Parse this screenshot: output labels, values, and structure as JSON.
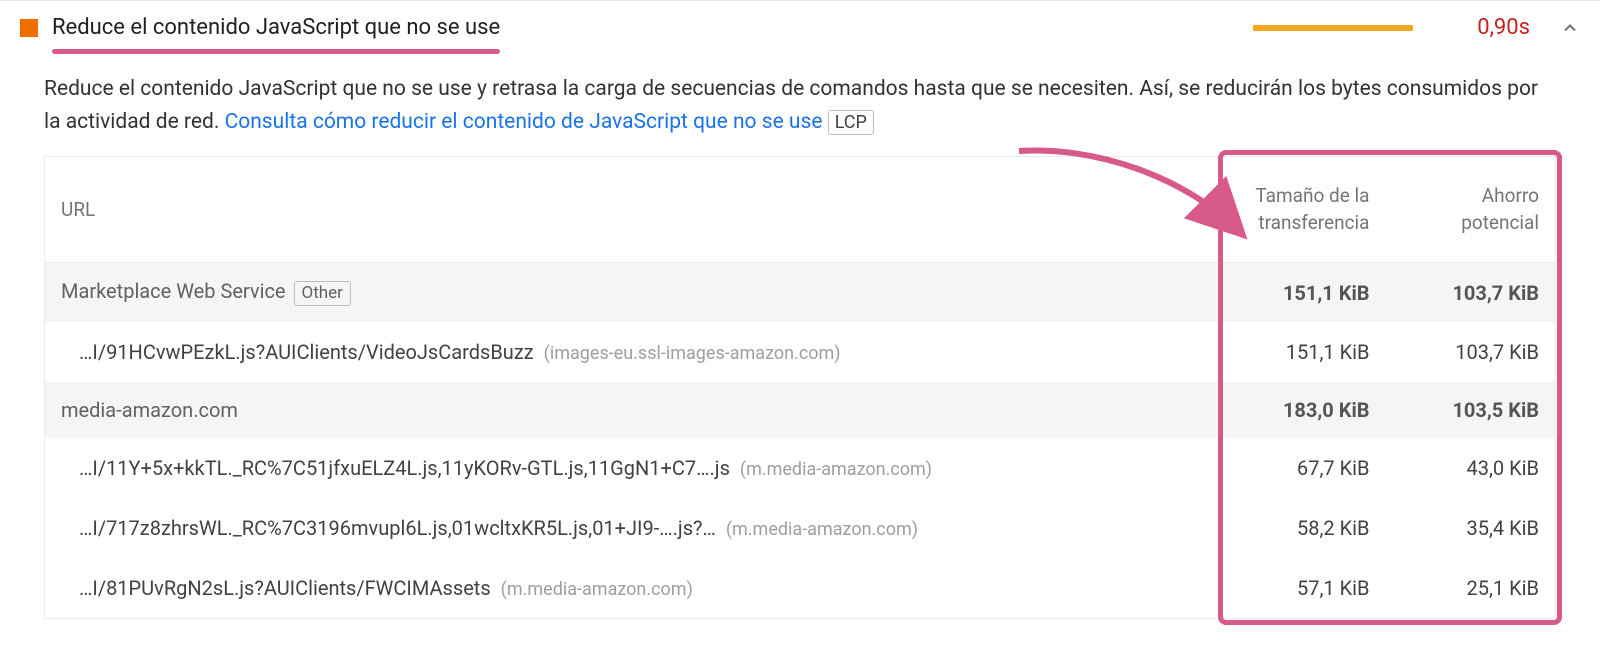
{
  "audit": {
    "title": "Reduce el contenido JavaScript que no se use",
    "time": "0,90s",
    "description_pre": "Reduce el contenido JavaScript que no se use y retrasa la carga de secuencias de comandos hasta que se necesiten. Así, se reducirán los bytes consumidos por la actividad de red. ",
    "link_text": "Consulta cómo reducir el contenido de JavaScript que no se use",
    "badge": "LCP"
  },
  "table": {
    "headers": {
      "url": "URL",
      "transfer": "Tamaño de la transferencia",
      "savings": "Ahorro potencial"
    },
    "rows": [
      {
        "type": "group",
        "label": "Marketplace Web Service",
        "tag": "Other",
        "transfer": "151,1 KiB",
        "savings": "103,7 KiB"
      },
      {
        "type": "item",
        "label": "…I/91HCvwPEzkL.js?AUIClients/VideoJsCardsBuzz",
        "domain": "(images-eu.ssl-images-amazon.com)",
        "transfer": "151,1 KiB",
        "savings": "103,7 KiB"
      },
      {
        "type": "group",
        "label": "media-amazon.com",
        "transfer": "183,0 KiB",
        "savings": "103,5 KiB"
      },
      {
        "type": "item",
        "label": "…I/11Y+5x+kkTL._RC%7C51jfxuELZ4L.js,11yKORv-GTL.js,11GgN1+C7….js",
        "domain": "(m.media-amazon.com)",
        "transfer": "67,7 KiB",
        "savings": "43,0 KiB"
      },
      {
        "type": "item",
        "label": "…I/717z8zhrsWL._RC%7C3196mvupl6L.js,01wcltxKR5L.js,01+JI9-….js?…",
        "domain": "(m.media-amazon.com)",
        "transfer": "58,2 KiB",
        "savings": "35,4 KiB"
      },
      {
        "type": "item",
        "label": "…I/81PUvRgN2sL.js?AUIClients/FWCIMAssets",
        "domain": "(m.media-amazon.com)",
        "transfer": "57,1 KiB",
        "savings": "25,1 KiB"
      }
    ]
  }
}
